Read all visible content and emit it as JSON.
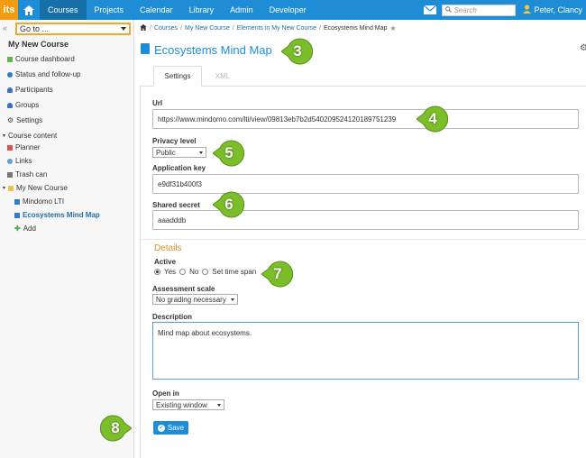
{
  "topnav": {
    "logo": "its",
    "items": [
      "Courses",
      "Projects",
      "Calendar",
      "Library",
      "Admin",
      "Developer"
    ],
    "search_placeholder": "Search",
    "user": "Peter, Clancy"
  },
  "sidebar": {
    "goto": "Go to ...",
    "course_title": "My New Course",
    "items": [
      {
        "label": "Course dashboard"
      },
      {
        "label": "Status and follow-up"
      },
      {
        "label": "Participants"
      },
      {
        "label": "Groups"
      },
      {
        "label": "Settings"
      }
    ],
    "content_section": "Course content",
    "content_items": [
      "Planner",
      "Links",
      "Trash can",
      "My New Course"
    ],
    "sub_items": [
      "Mindomo LTI",
      "Ecosystems Mind Map",
      "Add"
    ]
  },
  "breadcrumb": [
    "Courses",
    "My New Course",
    "Elements in My New Course",
    "Ecosystems Mind Map"
  ],
  "page": {
    "title": "Ecosystems Mind Map",
    "tabs": [
      "Settings",
      "XML"
    ]
  },
  "form": {
    "url_label": "Url",
    "url_value": "https://www.mindomo.com/lti/view/09813eb7b2d540209524120189751239",
    "privacy_label": "Privacy level",
    "privacy_value": "Public",
    "app_key_label": "Application key",
    "app_key_value": "e9df31b400f3",
    "secret_label": "Shared secret",
    "secret_value": "aaadddb",
    "details_heading": "Details",
    "active_label": "Active",
    "active_options": [
      "Yes",
      "No",
      "Set time span"
    ],
    "assessment_label": "Assessment scale",
    "assessment_value": "No grading necessary",
    "description_label": "Description",
    "description_value": "Mind map about ecosystems.",
    "open_in_label": "Open in",
    "open_in_value": "Existing window",
    "save_label": "Save"
  },
  "callouts": [
    "3",
    "4",
    "5",
    "6",
    "7",
    "8"
  ],
  "colors": {
    "nav": "#1f8dd6",
    "accent_orange": "#e08e2c",
    "callout_green": "#7cbd2a"
  }
}
